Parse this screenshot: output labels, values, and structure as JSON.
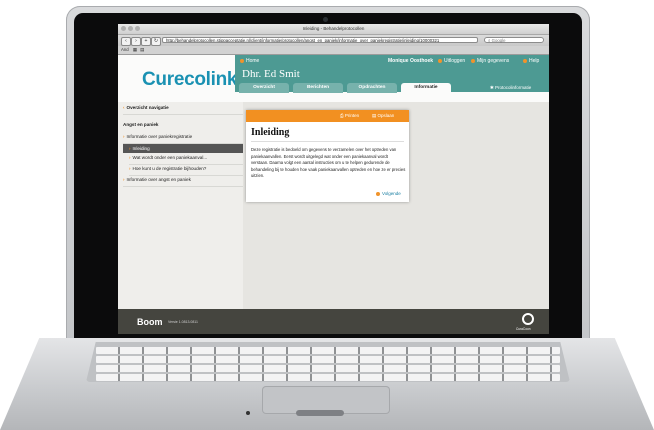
{
  "browser": {
    "window_title": "Inleiding - Behandelprotocollen",
    "url": "http://behandelprotocollen.stippacceptatie.nl/client/informatie/protocollen/angst_en_paniek/informatie_over_paniekregistratie/inleiding/10000321",
    "search_placeholder": "Google",
    "bookmarks_label": "And"
  },
  "header": {
    "logo": "Curecolink",
    "home": "Home",
    "user_name": "Dhr. Ed Smit",
    "current_user": "Monique Oosthoek",
    "logout": "Uitloggen",
    "my_data": "Mijn gegevens",
    "help": "Help",
    "tabs": [
      {
        "label": "Overzicht"
      },
      {
        "label": "Berichten"
      },
      {
        "label": "Opdrachten"
      },
      {
        "label": "Informatie"
      }
    ],
    "protocol_info": "Protocolinformatie"
  },
  "sidebar": {
    "overview_nav": "Overzicht navigatie",
    "section": "Angst en paniek",
    "items": [
      {
        "label": "Informatie over paniekregistratie"
      },
      {
        "label": "Inleiding"
      },
      {
        "label": "Wat wordt onder een paniekaanval..."
      },
      {
        "label": "Hoe kunt u de registratie bijhouden?"
      },
      {
        "label": "Informatie over angst en paniek"
      }
    ]
  },
  "dialog": {
    "print": "Printen",
    "save": "Opslaan",
    "title": "Inleiding",
    "body": "Deze registratie is bedoeld om gegevens te verzamelen over het optreden van paniekaanvallen. Eerst wordt uitgelegd wat onder een paniekaanval wordt verstaan. Daarna volgt een aantal instructies om u te helpen gedurende de behandeling bij te houden hoe vaak paniekaanvallen optreden en hoe ze er precies uitzien.",
    "next": "Volgende"
  },
  "footer": {
    "brand": "Boom",
    "version": "Versie 1.0813.0811",
    "logo_label": "CuraCoon"
  }
}
